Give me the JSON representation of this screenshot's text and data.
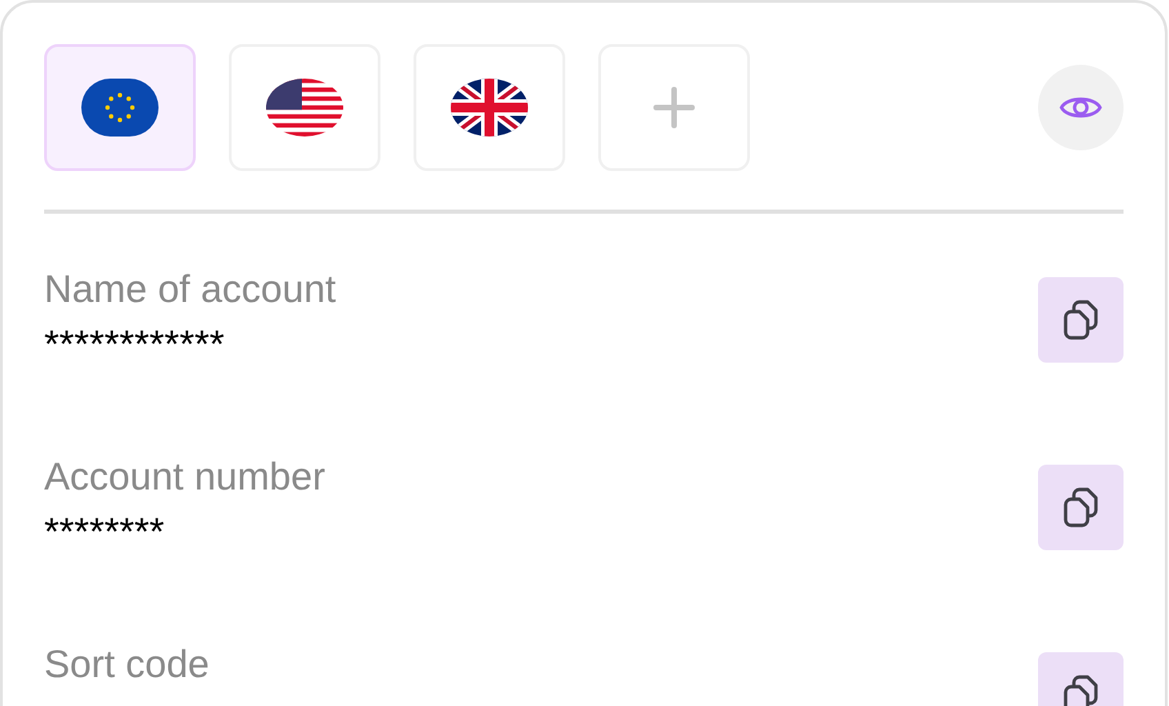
{
  "currencies": [
    {
      "kind": "eu",
      "selected": true
    },
    {
      "kind": "us",
      "selected": false
    },
    {
      "kind": "uk",
      "selected": false
    },
    {
      "kind": "add",
      "selected": false
    }
  ],
  "fields": [
    {
      "label": "Name of account",
      "value": "************"
    },
    {
      "label": "Account number",
      "value": "********"
    },
    {
      "label": "Sort code"
    }
  ]
}
